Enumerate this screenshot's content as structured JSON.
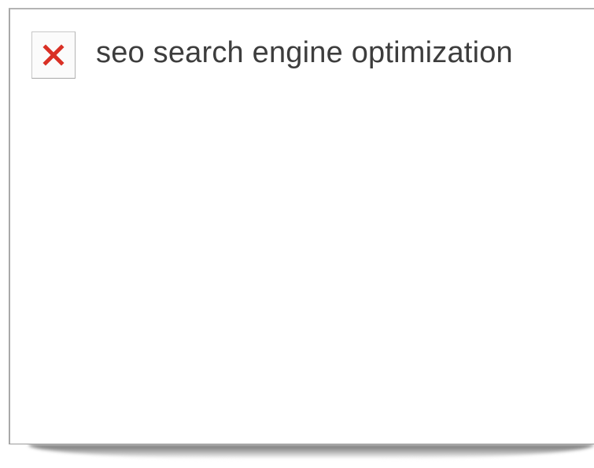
{
  "image": {
    "alt_text": "seo search engine optimization",
    "broken_icon": "broken-image-x-icon",
    "icon_color": "#d93025"
  }
}
